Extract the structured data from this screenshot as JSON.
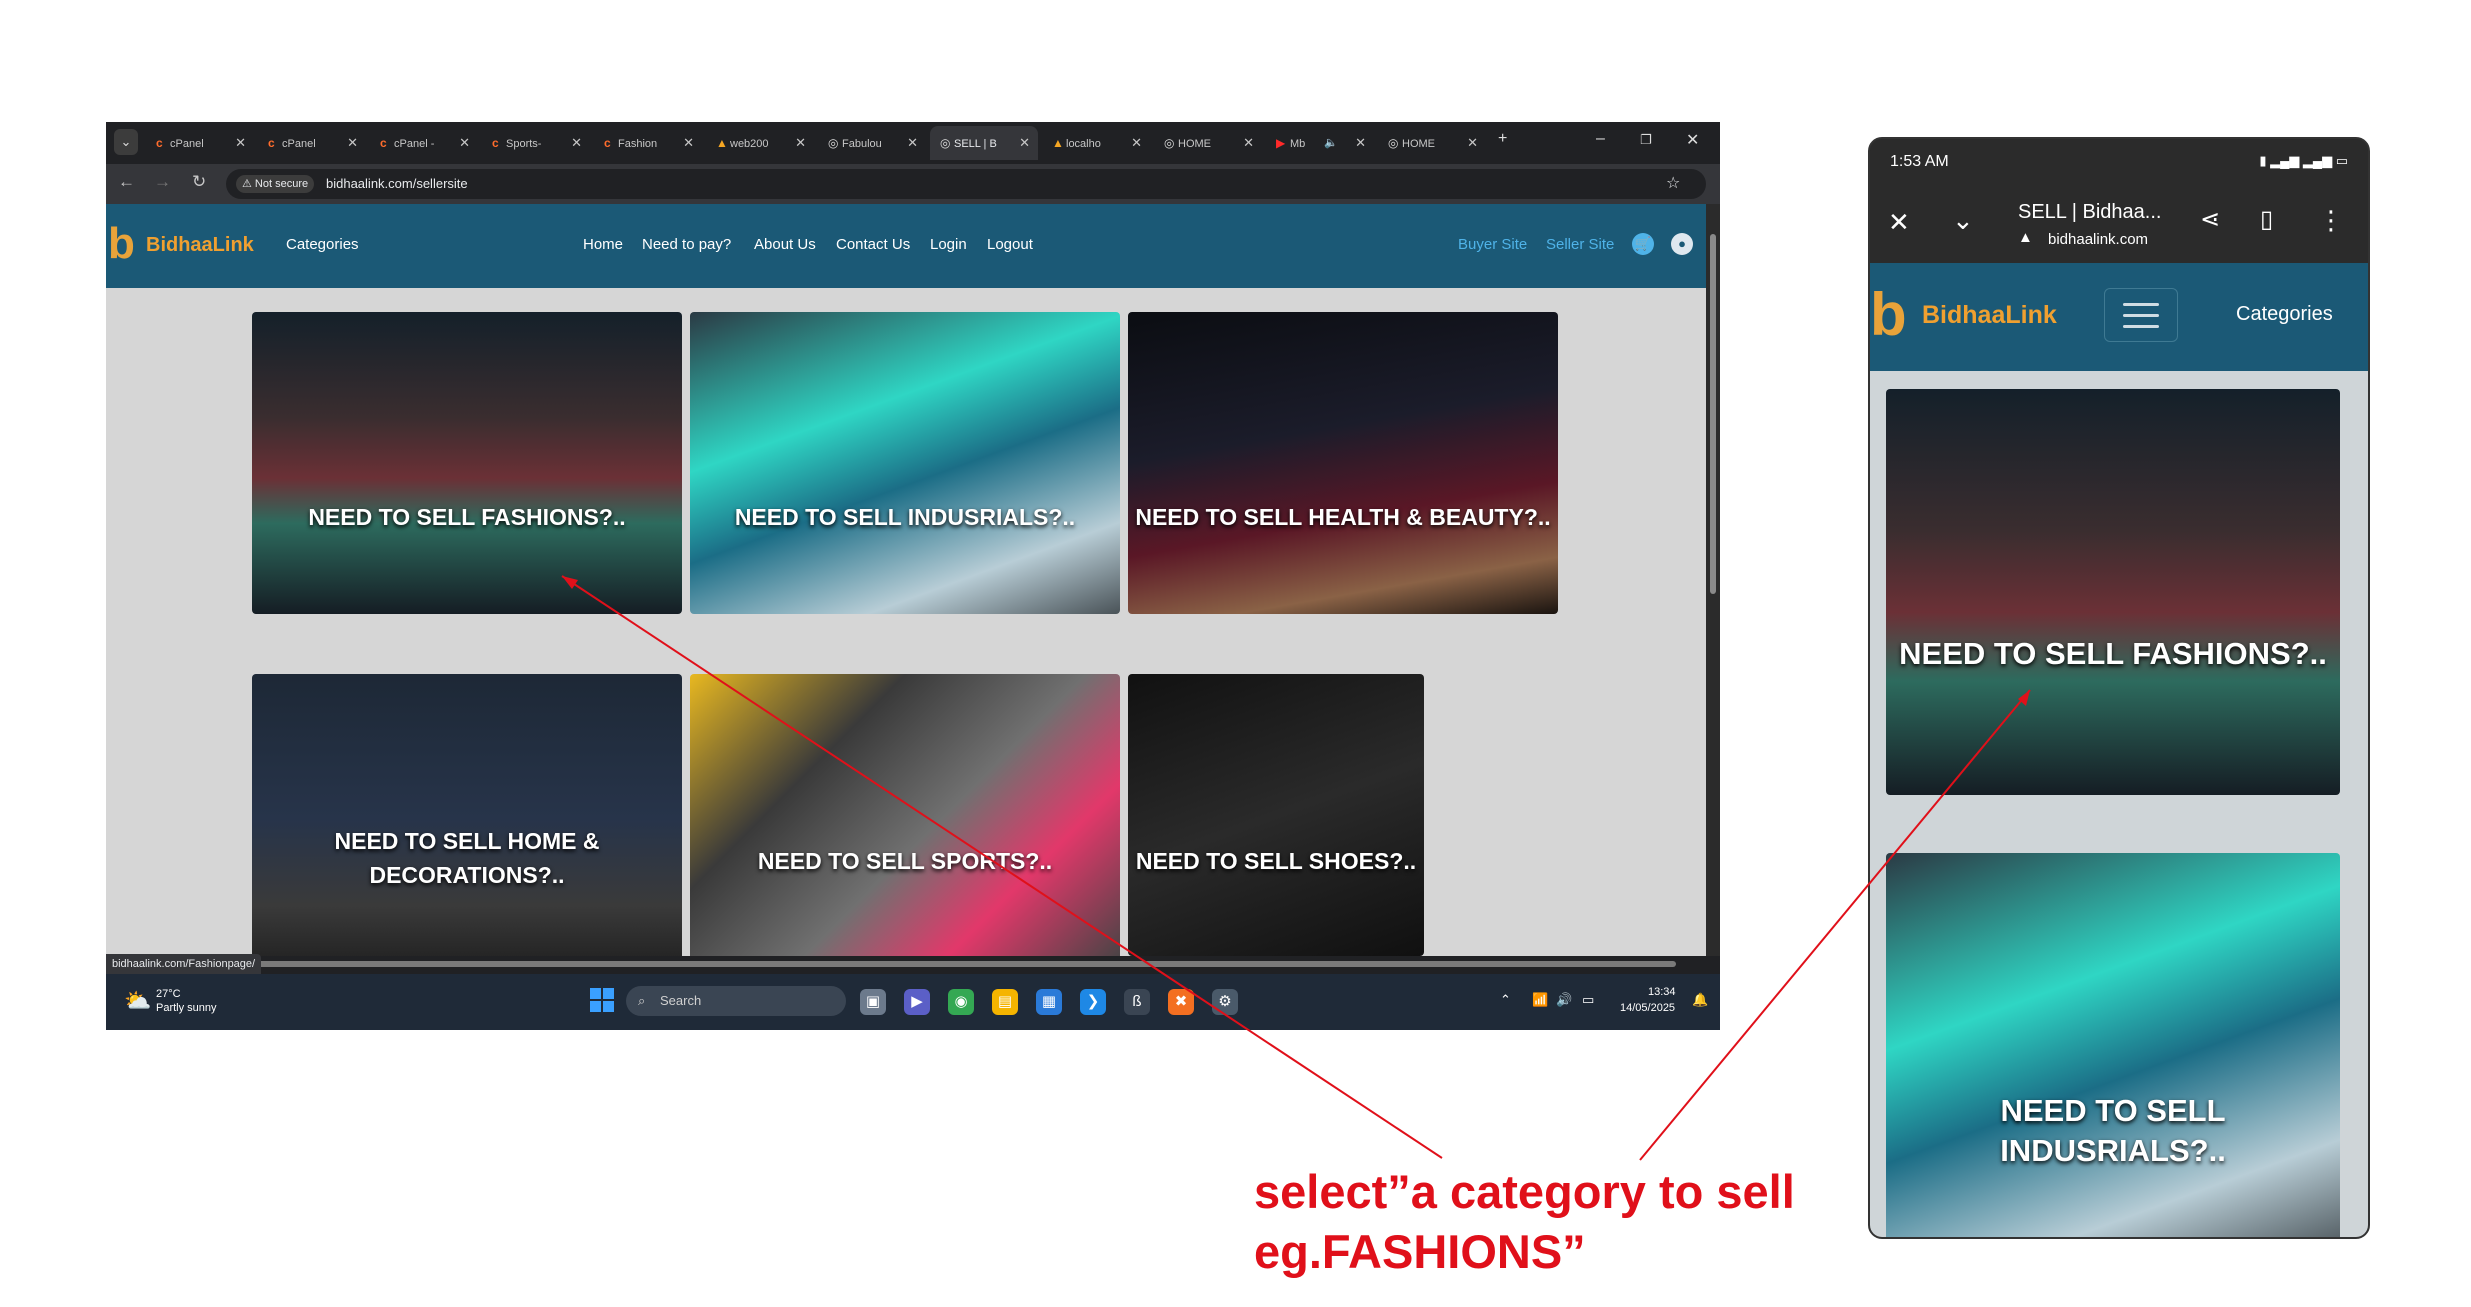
{
  "browser": {
    "tabs": [
      {
        "label": "cPanel"
      },
      {
        "label": "cPanel"
      },
      {
        "label": "cPanel -"
      },
      {
        "label": "Sports-"
      },
      {
        "label": "Fashion"
      },
      {
        "label": "web200"
      },
      {
        "label": "Fabulou"
      },
      {
        "label": "SELL | B",
        "active": true
      },
      {
        "label": "localho"
      },
      {
        "label": "HOME"
      },
      {
        "label": "Mb"
      },
      {
        "label": "HOME"
      }
    ],
    "not_secure": "Not secure",
    "url": "bidhaalink.com/sellersite",
    "status_url": "bidhaalink.com/Fashionpage/"
  },
  "site": {
    "brand": "BidhaaLink",
    "categories": "Categories",
    "nav": [
      "Home",
      "Need to pay?",
      "About Us",
      "Contact Us",
      "Login",
      "Logout"
    ],
    "buyer_site": "Buyer Site",
    "seller_site": "Seller Site",
    "cards": [
      {
        "label": "NEED TO SELL FASHIONS?.."
      },
      {
        "label": "NEED TO SELL INDUSRIALS?.."
      },
      {
        "label": "NEED TO SELL HEALTH & BEAUTY?.."
      },
      {
        "label": "NEED TO SELL HOME & DECORATIONS?.."
      },
      {
        "label": "NEED TO SELL SPORTS?.."
      },
      {
        "label": "NEED TO SELL SHOES?.."
      }
    ]
  },
  "taskbar": {
    "temp": "27°C",
    "weather": "Partly sunny",
    "search": "Search",
    "time": "13:34",
    "date": "14/05/2025"
  },
  "phone": {
    "time": "1:53 AM",
    "title": "SELL | Bidhaa...",
    "host": "bidhaalink.com",
    "brand": "BidhaaLink",
    "categories": "Categories",
    "cards": [
      {
        "label": "NEED TO SELL FASHIONS?.."
      },
      {
        "label": "NEED TO SELL INDUSRIALS?.."
      }
    ]
  },
  "annotation": {
    "line1": "select”a category to sell",
    "line2": "eg.FASHIONS”",
    "color": "#e0101a"
  }
}
